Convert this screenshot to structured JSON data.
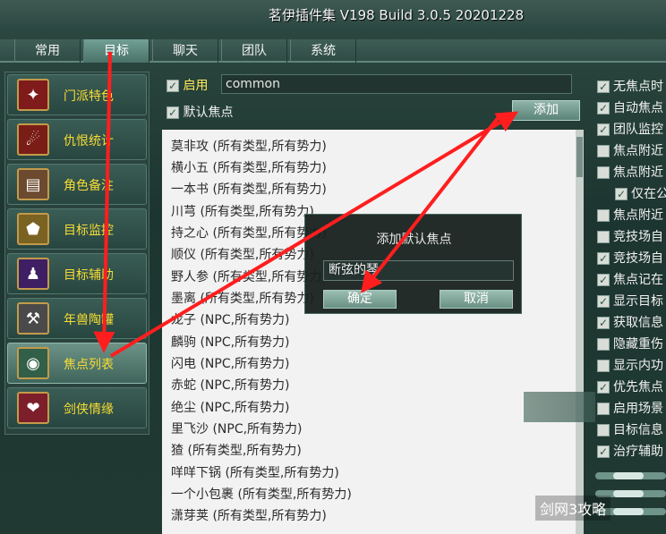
{
  "window": {
    "title": "茗伊插件集 V198 Build 3.0.5 20201228"
  },
  "tabs": [
    "常用",
    "目标",
    "聊天",
    "团队",
    "系统"
  ],
  "sidebar": {
    "items": [
      {
        "label": "门派特色",
        "icon": "phoenix-icon"
      },
      {
        "label": "仇恨统计",
        "icon": "rage-icon"
      },
      {
        "label": "角色备注",
        "icon": "book-icon"
      },
      {
        "label": "目标监控",
        "icon": "shield-icon"
      },
      {
        "label": "目标辅助",
        "icon": "silhouette-icon"
      },
      {
        "label": "年兽陶罐",
        "icon": "hammer-icon"
      },
      {
        "label": "焦点列表",
        "icon": "eye-icon"
      },
      {
        "label": "剑侠情缘",
        "icon": "heart-icon"
      }
    ]
  },
  "main": {
    "enable_label": "启用",
    "enable_value": "common",
    "default_focus_label": "默认焦点",
    "add_button": "添加",
    "list_items": [
      "莫非攻 (所有类型,所有势力)",
      "横小五 (所有类型,所有势力)",
      "一本书 (所有类型,所有势力)",
      "川芎 (所有类型,所有势力)",
      "持之心 (所有类型,所有势力)",
      "顺仪 (所有类型,所有势力)",
      "野人参 (所有类型,所有势力)",
      "墨离 (所有类型,所有势力)",
      "龙子 (NPC,所有势力)",
      "麟驹 (NPC,所有势力)",
      "闪电 (NPC,所有势力)",
      "赤蛇 (NPC,所有势力)",
      "绝尘 (NPC,所有势力)",
      "里飞沙 (NPC,所有势力)",
      "猹 (所有类型,所有势力)",
      "咩咩下锅 (所有类型,所有势力)",
      "一个小包裹 (所有类型,所有势力)",
      "潇芽荚 (所有类型,所有势力)"
    ]
  },
  "dialog": {
    "title": "添加默认焦点",
    "input_value": "断弦的琴",
    "confirm_label": "确定",
    "cancel_label": "取消"
  },
  "right_panel": {
    "items": [
      {
        "label": "无焦点时",
        "checked": true
      },
      {
        "label": "自动焦点",
        "checked": true
      },
      {
        "label": "团队监控",
        "checked": true
      },
      {
        "label": "焦点附近",
        "checked": false
      },
      {
        "label": "焦点附近",
        "checked": false
      },
      {
        "label": "仅在公",
        "checked": true
      },
      {
        "label": "焦点附近",
        "checked": false
      },
      {
        "label": "竞技场自",
        "checked": false
      },
      {
        "label": "竞技场自",
        "checked": true
      },
      {
        "label": "焦点记在",
        "checked": true
      },
      {
        "label": "显示目标",
        "checked": true
      },
      {
        "label": "获取信息",
        "checked": true
      },
      {
        "label": "隐藏重伤",
        "checked": false
      },
      {
        "label": "显示内功",
        "checked": false
      },
      {
        "label": "优先焦点",
        "checked": true
      },
      {
        "label": "启用场景",
        "checked": false
      },
      {
        "label": "目标信息",
        "checked": false
      },
      {
        "label": "治疗辅助",
        "checked": true
      }
    ],
    "slider_levels": [
      0.55,
      0.55,
      0.55
    ]
  },
  "watermark": "剑网3攻略",
  "colors": {
    "accent_yellow": "#f7dc34",
    "arrow_red": "#ff1e1e",
    "panel_green": "#2a443d"
  }
}
